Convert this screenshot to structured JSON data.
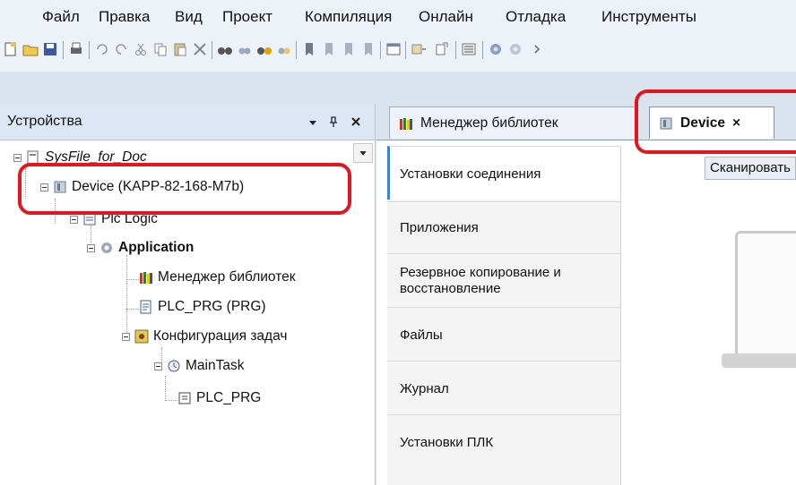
{
  "menu": {
    "items": [
      "Файл",
      "Правка",
      "Вид",
      "Проект",
      "Компиляция",
      "Онлайн",
      "Отладка",
      "Инструменты"
    ]
  },
  "devices_panel": {
    "title": "Устройства",
    "pin_glyph": "▾ ♯ ✕",
    "tree": {
      "project": "SysFile_for_Doc",
      "device": "Device (KAPP-82-168-M7b)",
      "plc_logic": "Plc Logic",
      "application": "Application",
      "library_manager": "Менеджер библиотек",
      "plc_prg": "PLC_PRG (PRG)",
      "task_config": "Конфигурация задач",
      "main_task": "MainTask",
      "task_plc_prg": "PLC_PRG"
    }
  },
  "tabs": [
    {
      "label": "Менеджер библиотек",
      "active": false
    },
    {
      "label": "Device",
      "active": true,
      "close": "×"
    }
  ],
  "device_editor": {
    "nav": [
      {
        "label": "Установки соединения",
        "selected": true
      },
      {
        "label": "Приложения",
        "selected": false
      },
      {
        "label": "Резервное копирование и восстановление",
        "selected": false
      },
      {
        "label": "Файлы",
        "selected": false
      },
      {
        "label": "Журнал",
        "selected": false
      },
      {
        "label": "Установки ПЛК",
        "selected": false
      }
    ],
    "scan_button": "Сканировать"
  },
  "colors": {
    "highlight": "#e3151f",
    "selected_accent": "#3a82d8"
  }
}
